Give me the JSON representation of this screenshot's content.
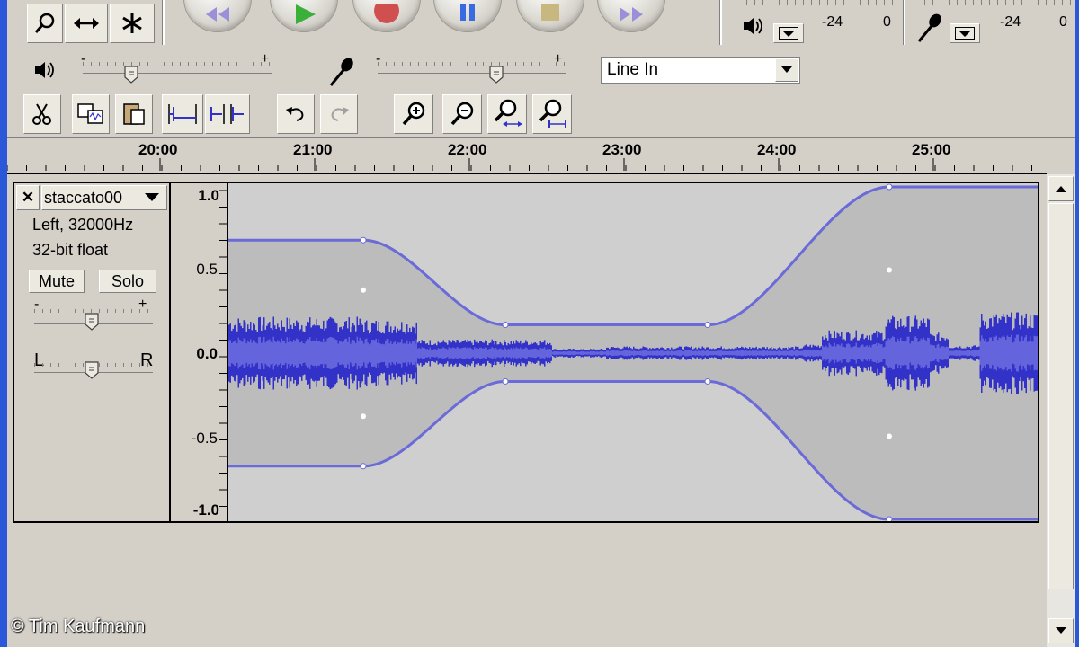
{
  "tools": {
    "zoom_icon": "magnifier-icon",
    "timeshift_icon": "double-arrow-icon",
    "multi_icon": "asterisk-icon"
  },
  "meters": {
    "playback_icon": "speaker-icon",
    "record_icon": "microphone-icon",
    "playback_scale": [
      "-24",
      "0"
    ],
    "record_scale": [
      "-24",
      "0"
    ]
  },
  "mixer": {
    "output_slider_min": "-",
    "output_slider_max": "+",
    "input_slider_min": "-",
    "input_slider_max": "+",
    "input_source": "Line In"
  },
  "timeline": {
    "labels": [
      "20:00",
      "21:00",
      "22:00",
      "23:00",
      "24:00",
      "25:00"
    ]
  },
  "track": {
    "close_label": "✕",
    "name": "staccato00",
    "info_channel": "Left, 32000Hz",
    "info_format": "32-bit float",
    "mute_label": "Mute",
    "solo_label": "Solo",
    "gain_min": "-",
    "gain_max": "+",
    "pan_left": "L",
    "pan_right": "R"
  },
  "vruler": {
    "labels": [
      "1.0",
      "0.5",
      "0.0",
      "-0.5",
      "-1.0"
    ]
  },
  "colors": {
    "waveform_dark": "#3232c8",
    "waveform_light": "#6464dc",
    "envelope": "#6a6ad8",
    "track_bg": "#cfcfcf",
    "envelope_fill": "#bcbcbc"
  },
  "copyright": "© Tim Kaufmann"
}
